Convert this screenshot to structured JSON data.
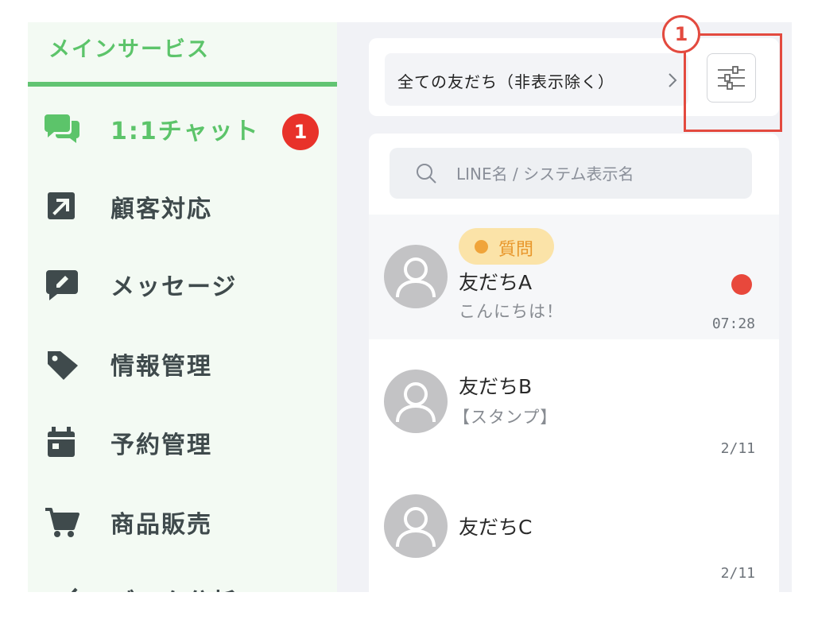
{
  "sidebar": {
    "title": "メインサービス",
    "accent_color": "#5cc46a",
    "items": [
      {
        "label": "1:1チャット",
        "icon": "chat-bubbles-icon",
        "active": true,
        "badge": "1"
      },
      {
        "label": "顧客対応",
        "icon": "arrow-up-right-icon"
      },
      {
        "label": "メッセージ",
        "icon": "message-edit-icon"
      },
      {
        "label": "情報管理",
        "icon": "tag-icon"
      },
      {
        "label": "予約管理",
        "icon": "calendar-icon"
      },
      {
        "label": "商品販売",
        "icon": "cart-icon"
      },
      {
        "label": "データ分析",
        "icon": "chart-icon"
      }
    ]
  },
  "filter": {
    "label": "全ての友だち（非表示除く）",
    "chevron_icon": "chevron-right-icon",
    "settings_icon": "sliders-icon"
  },
  "search": {
    "placeholder": "LINE名 / システム表示名",
    "icon": "search-icon"
  },
  "chats": [
    {
      "name": "友だちA",
      "preview": "こんにちは！",
      "time": "07:28",
      "tag": "質問",
      "unread": true
    },
    {
      "name": "友だちB",
      "preview": "【スタンプ】",
      "time": "2/11"
    },
    {
      "name": "友だちC",
      "preview": "",
      "time": "2/11"
    }
  ],
  "annotation": {
    "step": "1",
    "color": "#e34a3f"
  }
}
